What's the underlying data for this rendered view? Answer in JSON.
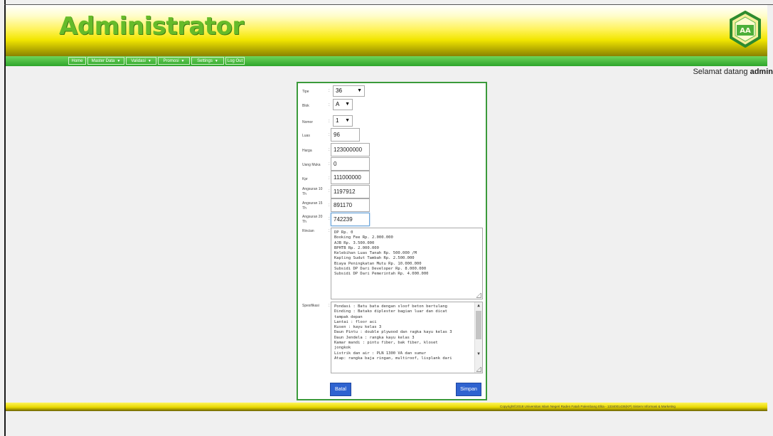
{
  "header": {
    "title": "Administrator",
    "logo_text": "AA"
  },
  "nav": {
    "items": [
      {
        "label": "Home",
        "has_caret": false
      },
      {
        "label": "Master Data",
        "has_caret": true
      },
      {
        "label": "Validasi",
        "has_caret": true
      },
      {
        "label": "Promosi",
        "has_caret": true
      },
      {
        "label": "Settings",
        "has_caret": true
      },
      {
        "label": "Log Out",
        "has_caret": false
      }
    ]
  },
  "welcome": {
    "prefix": "Selamat datang",
    "user": "admin"
  },
  "form": {
    "tipe": {
      "label": "Tipe",
      "value": "36"
    },
    "blok": {
      "label": "Blok",
      "value": "A"
    },
    "nomor": {
      "label": "Nomor",
      "value": "1"
    },
    "luas": {
      "label": "Luas",
      "value": "96"
    },
    "harga": {
      "label": "Harga",
      "value": "123000000"
    },
    "uang_muka": {
      "label": "Uang Muka",
      "value": "0"
    },
    "kpr": {
      "label": "Kpr",
      "value": "111000000"
    },
    "angsuran_10": {
      "label_1": "Angsuran 10",
      "label_2": "Th",
      "value": "1197912"
    },
    "angsuran_15": {
      "label_1": "Angsuran 15",
      "label_2": "Th",
      "value": "891170"
    },
    "angsuran_20": {
      "label_1": "Angsuran 20",
      "label_2": "Th",
      "value": "742239"
    },
    "rincian": {
      "label": "Rincian",
      "lines": [
        "DP Rp. 0",
        "Booking Fee Rp. 2.000.000",
        "AJB Rp. 3.500.000",
        "BPHTB Rp. 2.000.000",
        "Kelebihan Luas Tanah Rp. 500.000 /M",
        "Kapling Sudut Tambah Rp. 2.500.000",
        "Biaya Peningkatan Mutu Rp. 10.000.000",
        "Subsidi DP Dari Developer Rp. 8.000.000",
        "Subsidi DP Dari Pemerintah Rp. 4.000.000"
      ]
    },
    "spesifikasi": {
      "label": "Spesifikasi",
      "lines": [
        "Pondasi : Batu bata dengan sloof beton bertulang",
        "Dinding : Batako diplester bagian luar dan dicat",
        "tampak depan",
        "Lantai : floor aci",
        "Kusen : kayu kelas 3",
        "Daun Pintu : double plywood dan ragka kayu kelas 3",
        "Daun Jendela : rangka kayu kelas 3",
        "Kamar mandi : pintu fiber, bak fiber, kloset",
        "jongkok",
        "Listrik dan air : PLN 1300 VA dan sumur",
        "Atap: rangka baja ringan, multiroof, lisplank dari"
      ]
    },
    "batal_label": "Batal",
    "simpan_label": "Simpan"
  },
  "footer": {
    "text": "Copyright©2018 Universitas Islam Negeri Raden Fatah Palembang     Elita - 1334001436(KP) Sistem Informasi & Marketing"
  },
  "colors": {
    "title_green": "#66bb2a",
    "nav_green": "#2ea52b",
    "header_yellow": "#fff35a",
    "button_blue": "#2f63d0",
    "panel_border": "#3b9a3b"
  }
}
